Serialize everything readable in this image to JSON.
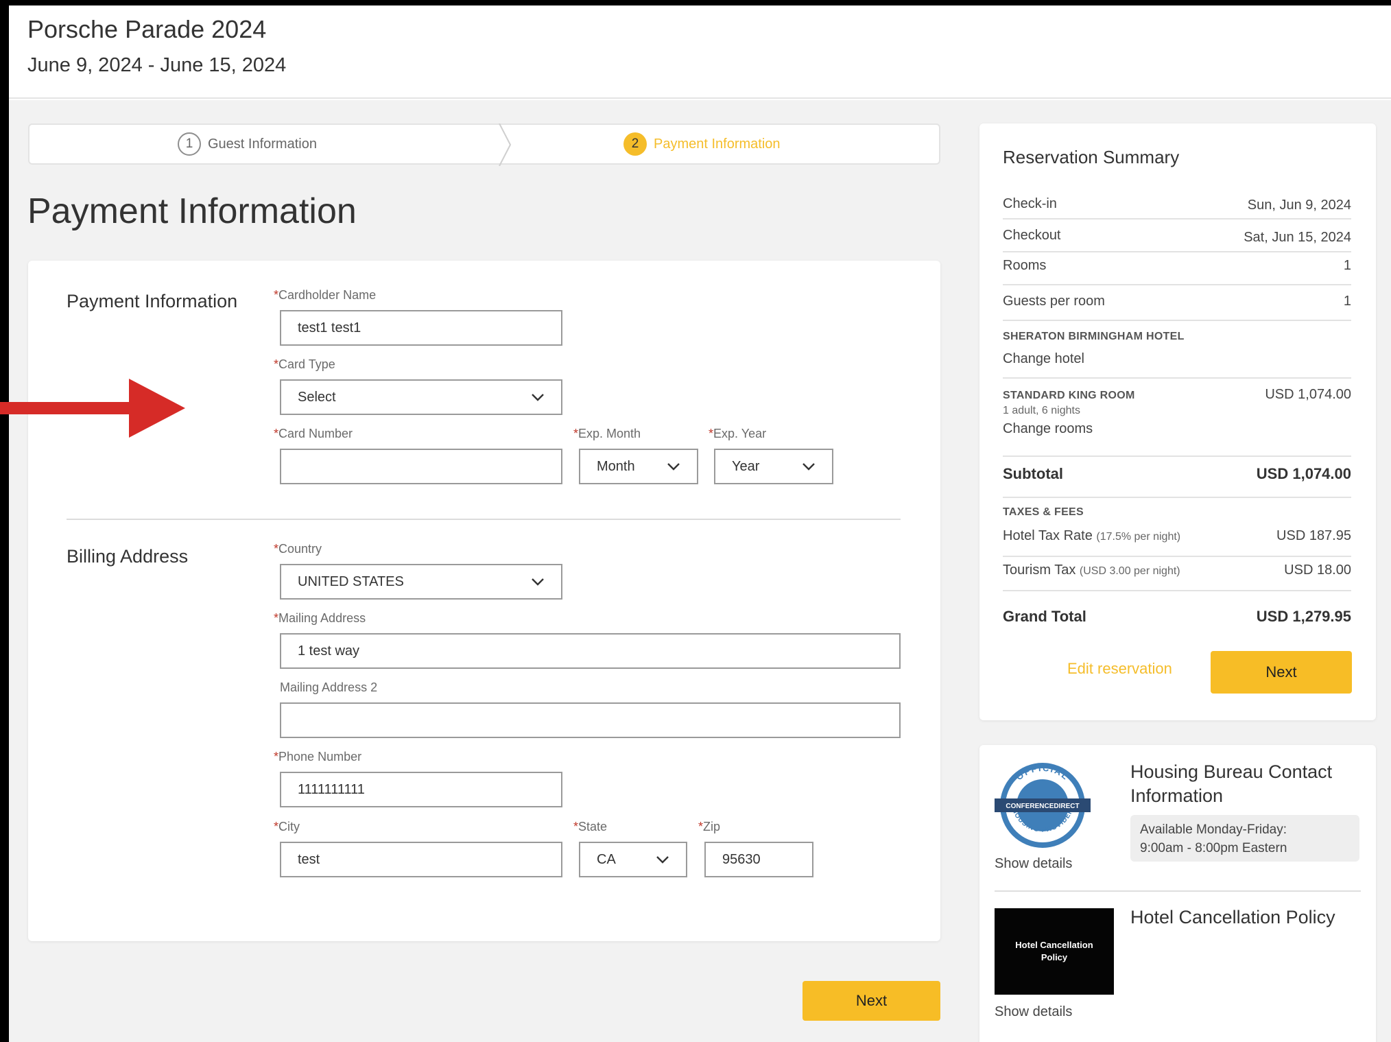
{
  "header": {
    "event_title": "Porsche Parade 2024",
    "event_dates": "June 9, 2024 - June 15, 2024"
  },
  "stepper": {
    "steps": [
      {
        "number": "1",
        "label": "Guest Information"
      },
      {
        "number": "2",
        "label": "Payment Information"
      }
    ]
  },
  "page_title": "Payment Information",
  "payment_section": {
    "title": "Payment Information",
    "cardholder_label": "Cardholder Name",
    "cardholder_value": "test1 test1",
    "card_type_label": "Card Type",
    "card_type_value": "Select",
    "card_number_label": "Card Number",
    "card_number_value": "",
    "exp_month_label": "Exp. Month",
    "exp_month_value": "Month",
    "exp_year_label": "Exp. Year",
    "exp_year_value": "Year"
  },
  "billing_section": {
    "title": "Billing Address",
    "country_label": "Country",
    "country_value": "UNITED STATES",
    "mailing_label": "Mailing Address",
    "mailing_value": "1 test way",
    "mailing2_label": "Mailing Address 2",
    "mailing2_value": "",
    "phone_label": "Phone Number",
    "phone_value": "1111111111",
    "city_label": "City",
    "city_value": "test",
    "state_label": "State",
    "state_value": "CA",
    "zip_label": "Zip",
    "zip_value": "95630"
  },
  "required_marker": "*",
  "next_label": "Next",
  "summary": {
    "title": "Reservation Summary",
    "checkin_label": "Check-in",
    "checkin_value": "Sun, Jun 9, 2024",
    "checkout_label": "Checkout",
    "checkout_value": "Sat, Jun 15, 2024",
    "rooms_label": "Rooms",
    "rooms_value": "1",
    "guests_label": "Guests per room",
    "guests_value": "1",
    "hotel_name": "SHERATON BIRMINGHAM HOTEL",
    "change_hotel": "Change hotel",
    "room_type": "STANDARD KING ROOM",
    "room_price": "USD 1,074.00",
    "room_detail": "1 adult, 6 nights",
    "change_rooms": "Change rooms",
    "subtotal_label": "Subtotal",
    "subtotal_value": "USD 1,074.00",
    "taxes_label": "TAXES & FEES",
    "hotel_tax_label": "Hotel Tax Rate",
    "hotel_tax_note": "(17.5% per night)",
    "hotel_tax_value": "USD 187.95",
    "tourism_tax_label": "Tourism Tax",
    "tourism_tax_note": "(USD 3.00 per night)",
    "tourism_tax_value": "USD 18.00",
    "grand_total_label": "Grand Total",
    "grand_total_value": "USD 1,279.95",
    "edit_reservation": "Edit reservation",
    "next_label": "Next"
  },
  "contact": {
    "title": "Housing Bureau Contact Information",
    "availability_line1": "Available Monday-Friday:",
    "availability_line2": "9:00am - 8:00pm Eastern",
    "show_details": "Show details",
    "seal_top_text": "OFFICIAL",
    "seal_band_text": "CONFERENCEDIRECT",
    "seal_bottom_text": "HOUSING PROVIDER",
    "policy_title": "Hotel Cancellation Policy",
    "policy_image_text": "Hotel Cancellation Policy",
    "policy_show_details": "Show details"
  },
  "colors": {
    "accent": "#f7bd26",
    "annotation_arrow": "#d62b27",
    "page_bg": "#f2f2f2"
  },
  "icons": {
    "dropdown": "chevron-down-icon",
    "annotation": "red-arrow-icon",
    "step_separator": "chevron-right-icon"
  }
}
